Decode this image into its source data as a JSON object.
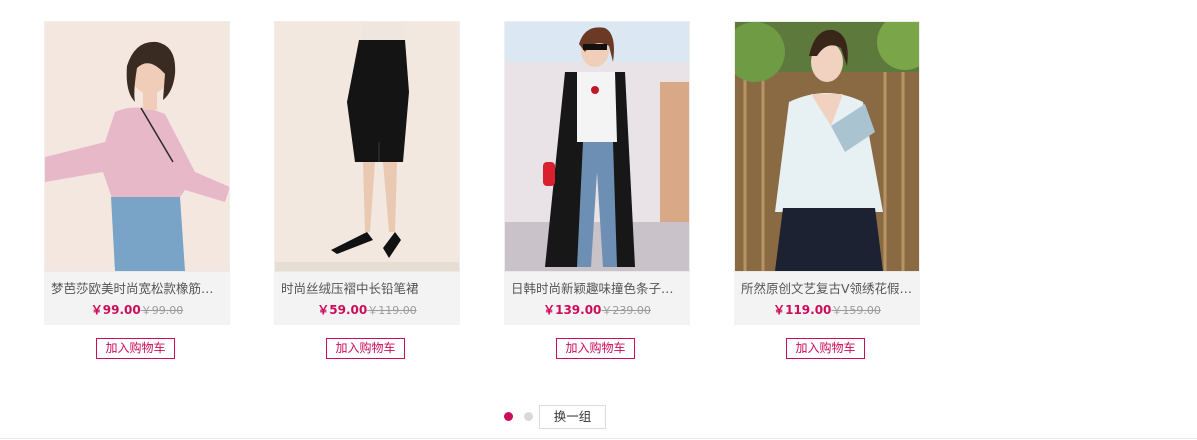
{
  "products": [
    {
      "name": "梦芭莎欧美时尚宽松款橡筋荷…",
      "price": "￥99.00",
      "original_price": "￥99.00",
      "cart_label": "加入购物车"
    },
    {
      "name": "时尚丝绒压褶中长铅笔裙",
      "price": "￥59.00",
      "original_price": "￥119.00",
      "cart_label": "加入购物车"
    },
    {
      "name": "日韩时尚新颖趣味撞色条子装…",
      "price": "￥139.00",
      "original_price": "￥239.00",
      "cart_label": "加入购物车"
    },
    {
      "name": "所然原创文艺复古V领绣花假…",
      "price": "￥119.00",
      "original_price": "￥159.00",
      "cart_label": "加入购物车"
    }
  ],
  "pager": {
    "switch_label": "换一组",
    "active_index": 0,
    "total": 2
  },
  "colors": {
    "accent": "#cc0b5a",
    "info_bg": "#f3f3f3",
    "muted": "#9a9a9a"
  }
}
